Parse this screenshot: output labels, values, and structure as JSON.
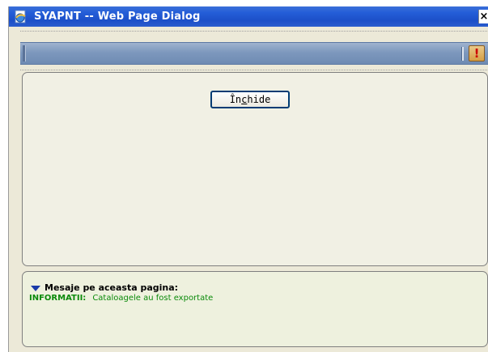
{
  "window": {
    "title": "SYAPNT -- Web Page Dialog",
    "close_glyph": "×"
  },
  "toolbar": {
    "alert_glyph": "!"
  },
  "main": {
    "close_button_label_prefix": "În",
    "close_button_label_underlined": "c",
    "close_button_label_suffix": "hide"
  },
  "messages": {
    "header": "Mesaje pe aceasta pagina:",
    "items": [
      {
        "type": "INFORMATII:",
        "text": "Cataloagele au fost exportate"
      }
    ]
  },
  "colors": {
    "titlebar": "#245ed8",
    "message_text": "#0a8a0a",
    "toolbar": "#7d98bd"
  }
}
